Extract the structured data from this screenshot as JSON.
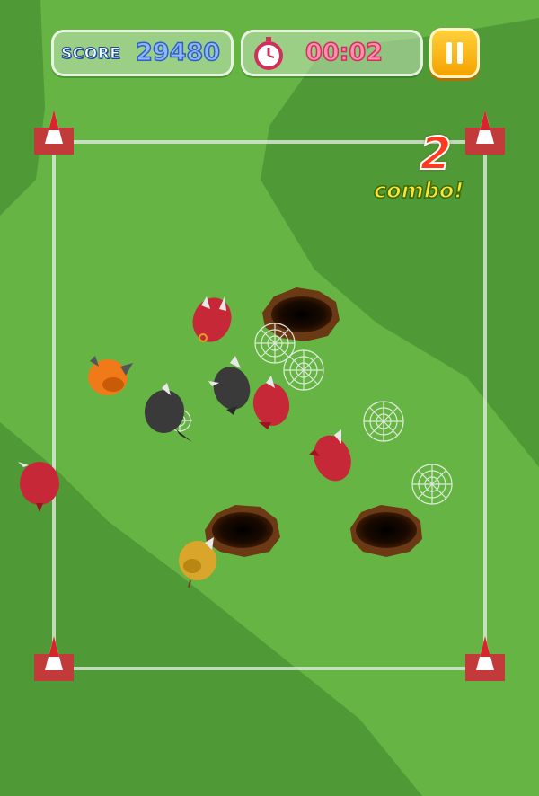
{
  "hud": {
    "score_label": "SCORE",
    "score_value": "29480",
    "timer_value": "00:02"
  },
  "combo": {
    "count": "2",
    "label": "combo!"
  },
  "icons": {
    "timer": "stopwatch-icon",
    "pause": "pause-icon"
  },
  "colors": {
    "grass_light": "#67b543",
    "grass_dark": "#4f9a36",
    "score_text": "#8fb8ff",
    "timer_text": "#ff8fb0",
    "pause_button": "#f5b400",
    "combo_number": "#ff3a1e",
    "combo_text": "#ffe33a"
  },
  "creatures": [
    {
      "kind": "red-beetle"
    },
    {
      "kind": "orange-beetle"
    },
    {
      "kind": "black-beetle"
    },
    {
      "kind": "black-beetle"
    },
    {
      "kind": "red-beetle"
    },
    {
      "kind": "red-beetle"
    },
    {
      "kind": "red-beetle"
    },
    {
      "kind": "yellow-beetle"
    }
  ],
  "holes_count": 3,
  "webs_count": 5
}
